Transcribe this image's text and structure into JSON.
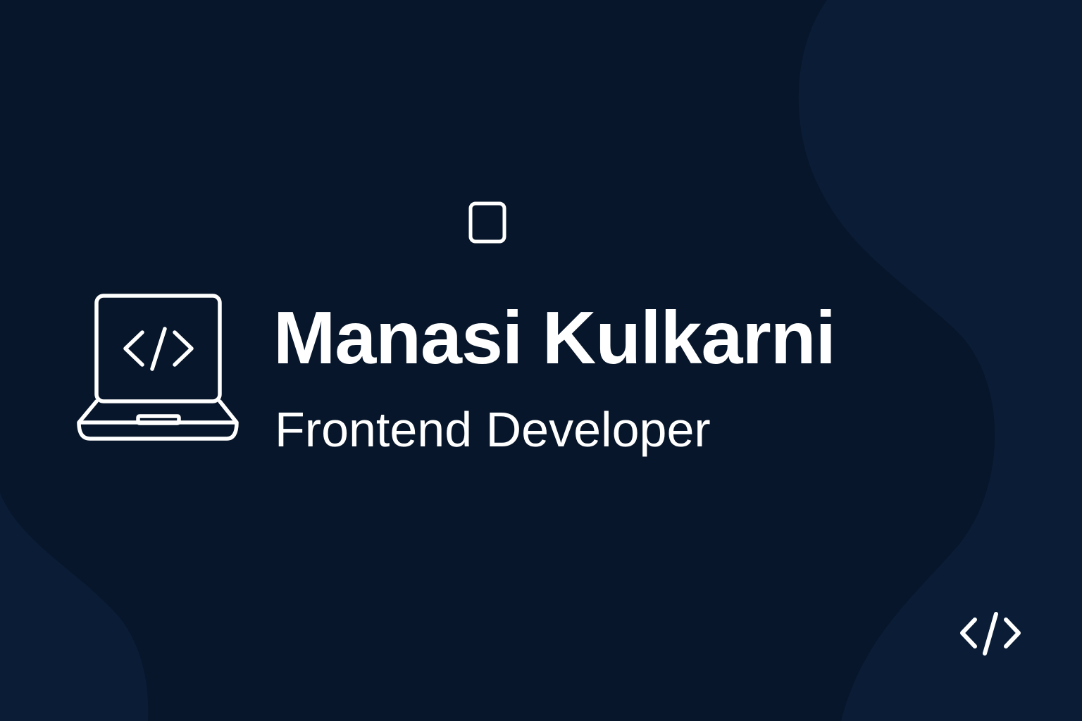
{
  "profile": {
    "name": "Manasi Kulkarni",
    "title": "Frontend Developer"
  },
  "icons": {
    "primary": "laptop-code-icon",
    "top": "square-outline-icon",
    "corner": "code-brackets-icon"
  },
  "colors": {
    "background": "#07162a",
    "accent_shape": "#0b1d36",
    "text": "#ffffff"
  }
}
